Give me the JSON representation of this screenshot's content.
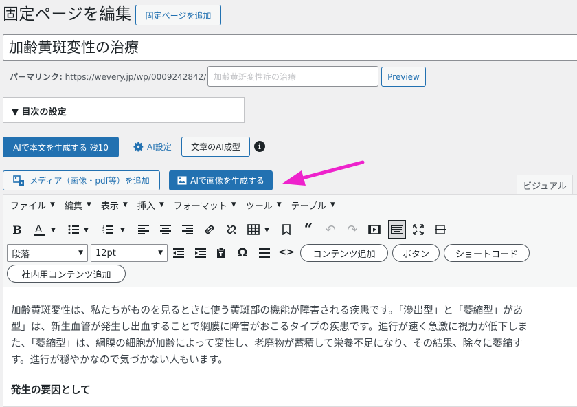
{
  "header": {
    "title": "固定ページを編集",
    "add_button": "固定ページを追加"
  },
  "post": {
    "title": "加齢黄斑変性の治療",
    "permalink_label": "パーマリンク:",
    "permalink_url": "https://wevery.jp/wp/0009242842/",
    "slug_placeholder": "加齢黄斑変性症の治療",
    "preview_button": "Preview"
  },
  "toc": {
    "label": "▼ 目次の設定"
  },
  "ai": {
    "generate_text_button": "AIで本文を生成する 残10",
    "settings_label": "AI設定",
    "format_button": "文章のAI成型",
    "info_icon": "info-icon",
    "generate_image_button": "AIで画像を生成する"
  },
  "media": {
    "add_media_button": "メディア（画像・pdf等）を追加"
  },
  "editor": {
    "tab_visual": "ビジュアル",
    "menus": [
      "ファイル",
      "編集",
      "表示",
      "挿入",
      "フォーマット",
      "ツール",
      "テーブル"
    ],
    "format_select": "段落",
    "size_select": "12pt",
    "pill_buttons": [
      "コンテンツ追加",
      "ボタン",
      "ショートコード"
    ],
    "pill_row2": "社内用コンテンツ追加"
  },
  "content": {
    "paragraph_lines": [
      "加齢黄斑変性は、私たちがものを見るときに使う黄斑部の機能が障害される疾患です。「滲出型」と「萎縮型」があ",
      "型」は、新生血管が発生し出血することで網膜に障害がおこるタイプの疾患です。進行が速く急激に視力が低下しま",
      "た、「萎縮型」は、網膜の細胞が加齢によって変性し、老廃物が蓄積して栄養不足になり、その結果、除々に萎縮す",
      "す。進行が穏やかなので気づかない人もいます。"
    ],
    "heading": "発生の要因として"
  },
  "colors": {
    "accent": "#2271b1",
    "arrow": "#ee22cc",
    "background": "#f0f0f1"
  }
}
